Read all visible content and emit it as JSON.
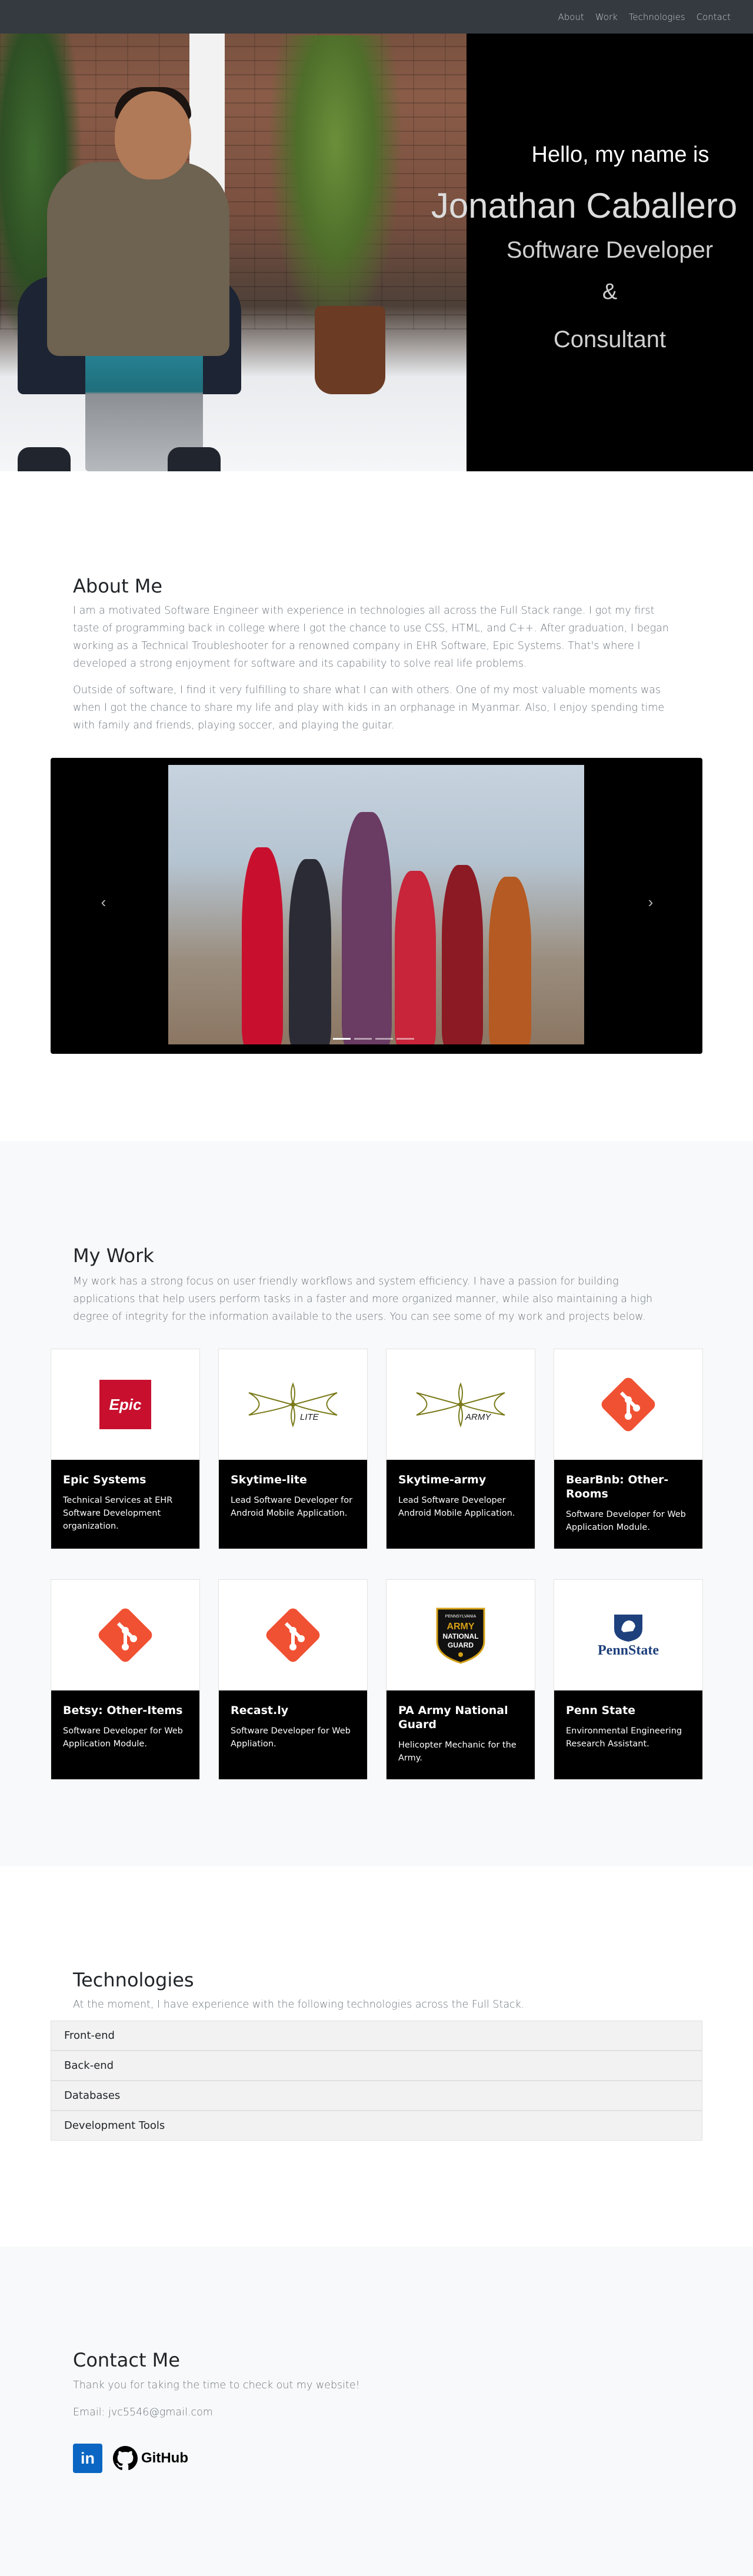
{
  "nav": {
    "items": [
      "About",
      "Work",
      "Technologies",
      "Contact"
    ]
  },
  "hero": {
    "hello": "Hello, my name is",
    "name": "Jonathan Caballero",
    "role": "Software Developer",
    "amp": "&",
    "role2": "Consultant"
  },
  "about": {
    "title": "About Me",
    "p1": "I am a motivated Software Engineer with experience in technologies all across the Full Stack range. I got my first taste of programming back in college where I got the chance to use CSS, HTML, and C++. After graduation, I began working as a Technical Troubleshooter for a renowned company in EHR Software, Epic Systems. That's where I developed a strong enjoyment for software and its capability to solve real life problems.",
    "p2": "Outside of software, I find it very fulfilling to share what I can with others. One of my most valuable moments was when I got the chance to share my life and play with kids in an orphanage in Myanmar. Also, I enjoy spending time with family and friends, playing soccer, and playing the guitar."
  },
  "work": {
    "title": "My Work",
    "p": "My work has a strong focus on user friendly workflows and system efficiency. I have a passion for building applications that help users perform tasks in a faster and more organized manner, while also maintaining a high degree of integrity for the information available to the users. You can see some of my work and projects below.",
    "cards": [
      {
        "title": "Epic Systems",
        "text": "Technical Services at EHR Software Development organization.",
        "logo": "epic-logo",
        "logo_text": "Epic"
      },
      {
        "title": "Skytime-lite",
        "text": "Lead Software Developer for Android Mobile Application.",
        "logo": "skytime-lite-logo",
        "logo_text": "LITE"
      },
      {
        "title": "Skytime-army",
        "text": "Lead Software Developer Android Mobile Application.",
        "logo": "skytime-army-logo",
        "logo_text": "ARMY"
      },
      {
        "title": "BearBnb: Other-Rooms",
        "text": "Software Developer for Web Application Module.",
        "logo": "git-icon"
      },
      {
        "title": "Betsy: Other-Items",
        "text": "Software Developer for Web Application Module.",
        "logo": "git-icon"
      },
      {
        "title": "Recast.ly",
        "text": "Software Developer for Web Appliation.",
        "logo": "git-icon"
      },
      {
        "title": "PA Army National Guard",
        "text": "Helicopter Mechanic for the Army.",
        "logo": "army-guard-logo",
        "logo_text": [
          "PENNSYLVANIA",
          "ARMY",
          "NATIONAL",
          "GUARD"
        ]
      },
      {
        "title": "Penn State",
        "text": "Environmental Engineering Research Assistant.",
        "logo": "penn-state-logo",
        "logo_text": "PennState"
      }
    ]
  },
  "tech": {
    "title": "Technologies",
    "p": "At the moment, I have experience with the following technologies across the Full Stack.",
    "items": [
      "Front-end",
      "Back-end",
      "Databases",
      "Development Tools"
    ]
  },
  "contact": {
    "title": "Contact Me",
    "thanks": "Thank you for taking the time to check out my website!",
    "email": "Email: jvc5546@gmail.com",
    "linkedin": "in",
    "github": "GitHub"
  },
  "colors": {
    "nav_bg": "#343a40",
    "epic_red": "#c8102e",
    "git_orange": "#f05133",
    "linkedin_blue": "#0a66c2",
    "penn_state_blue": "#1e407c"
  }
}
